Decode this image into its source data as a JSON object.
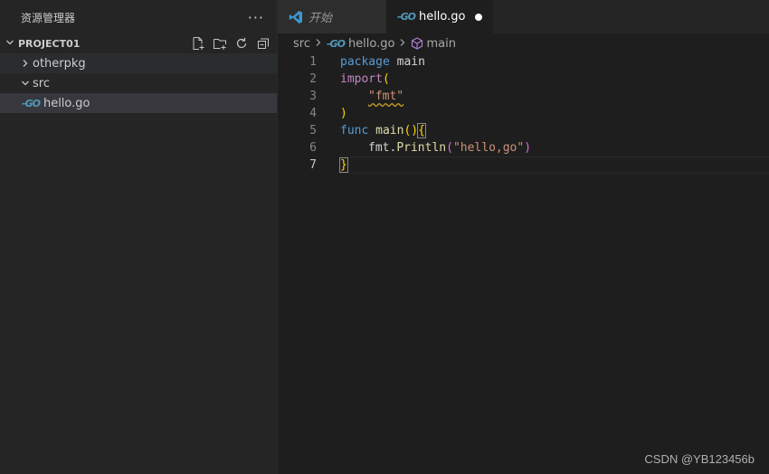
{
  "sidebar": {
    "title": "资源管理器",
    "more": "···",
    "section": "PROJECT01",
    "items": [
      {
        "label": "otherpkg"
      },
      {
        "label": "src"
      },
      {
        "label": "hello.go",
        "icon_text": "-GO"
      }
    ]
  },
  "tabs": [
    {
      "label": "开始"
    },
    {
      "label": "hello.go",
      "icon_text": "-GO",
      "modified": true
    }
  ],
  "breadcrumb": {
    "folder": "src",
    "file": "hello.go",
    "file_icon_text": "-GO",
    "symbol": "main"
  },
  "editor": {
    "line_numbers": [
      "1",
      "2",
      "3",
      "4",
      "5",
      "6",
      "7"
    ],
    "current_line": 7,
    "tokens": {
      "package_kw": "package",
      "package_name": "main",
      "import_kw": "import",
      "open_paren": "(",
      "fmt_str": "\"fmt\"",
      "close_paren": ")",
      "func_kw": "func",
      "main_fn": "main",
      "parens": "()",
      "open_brace": "{",
      "fmt_pkg": "fmt.",
      "println": "Println",
      "call_open": "(",
      "hello_str": "\"hello,go\"",
      "call_close": ")",
      "close_brace": "}"
    }
  },
  "colors": {
    "keyword": "#569cd6",
    "string": "#ce9178",
    "function": "#dcdcaa",
    "go_icon": "#519aba",
    "vscode_icon": "#3c99d4"
  },
  "watermark": "CSDN @YB123456b"
}
